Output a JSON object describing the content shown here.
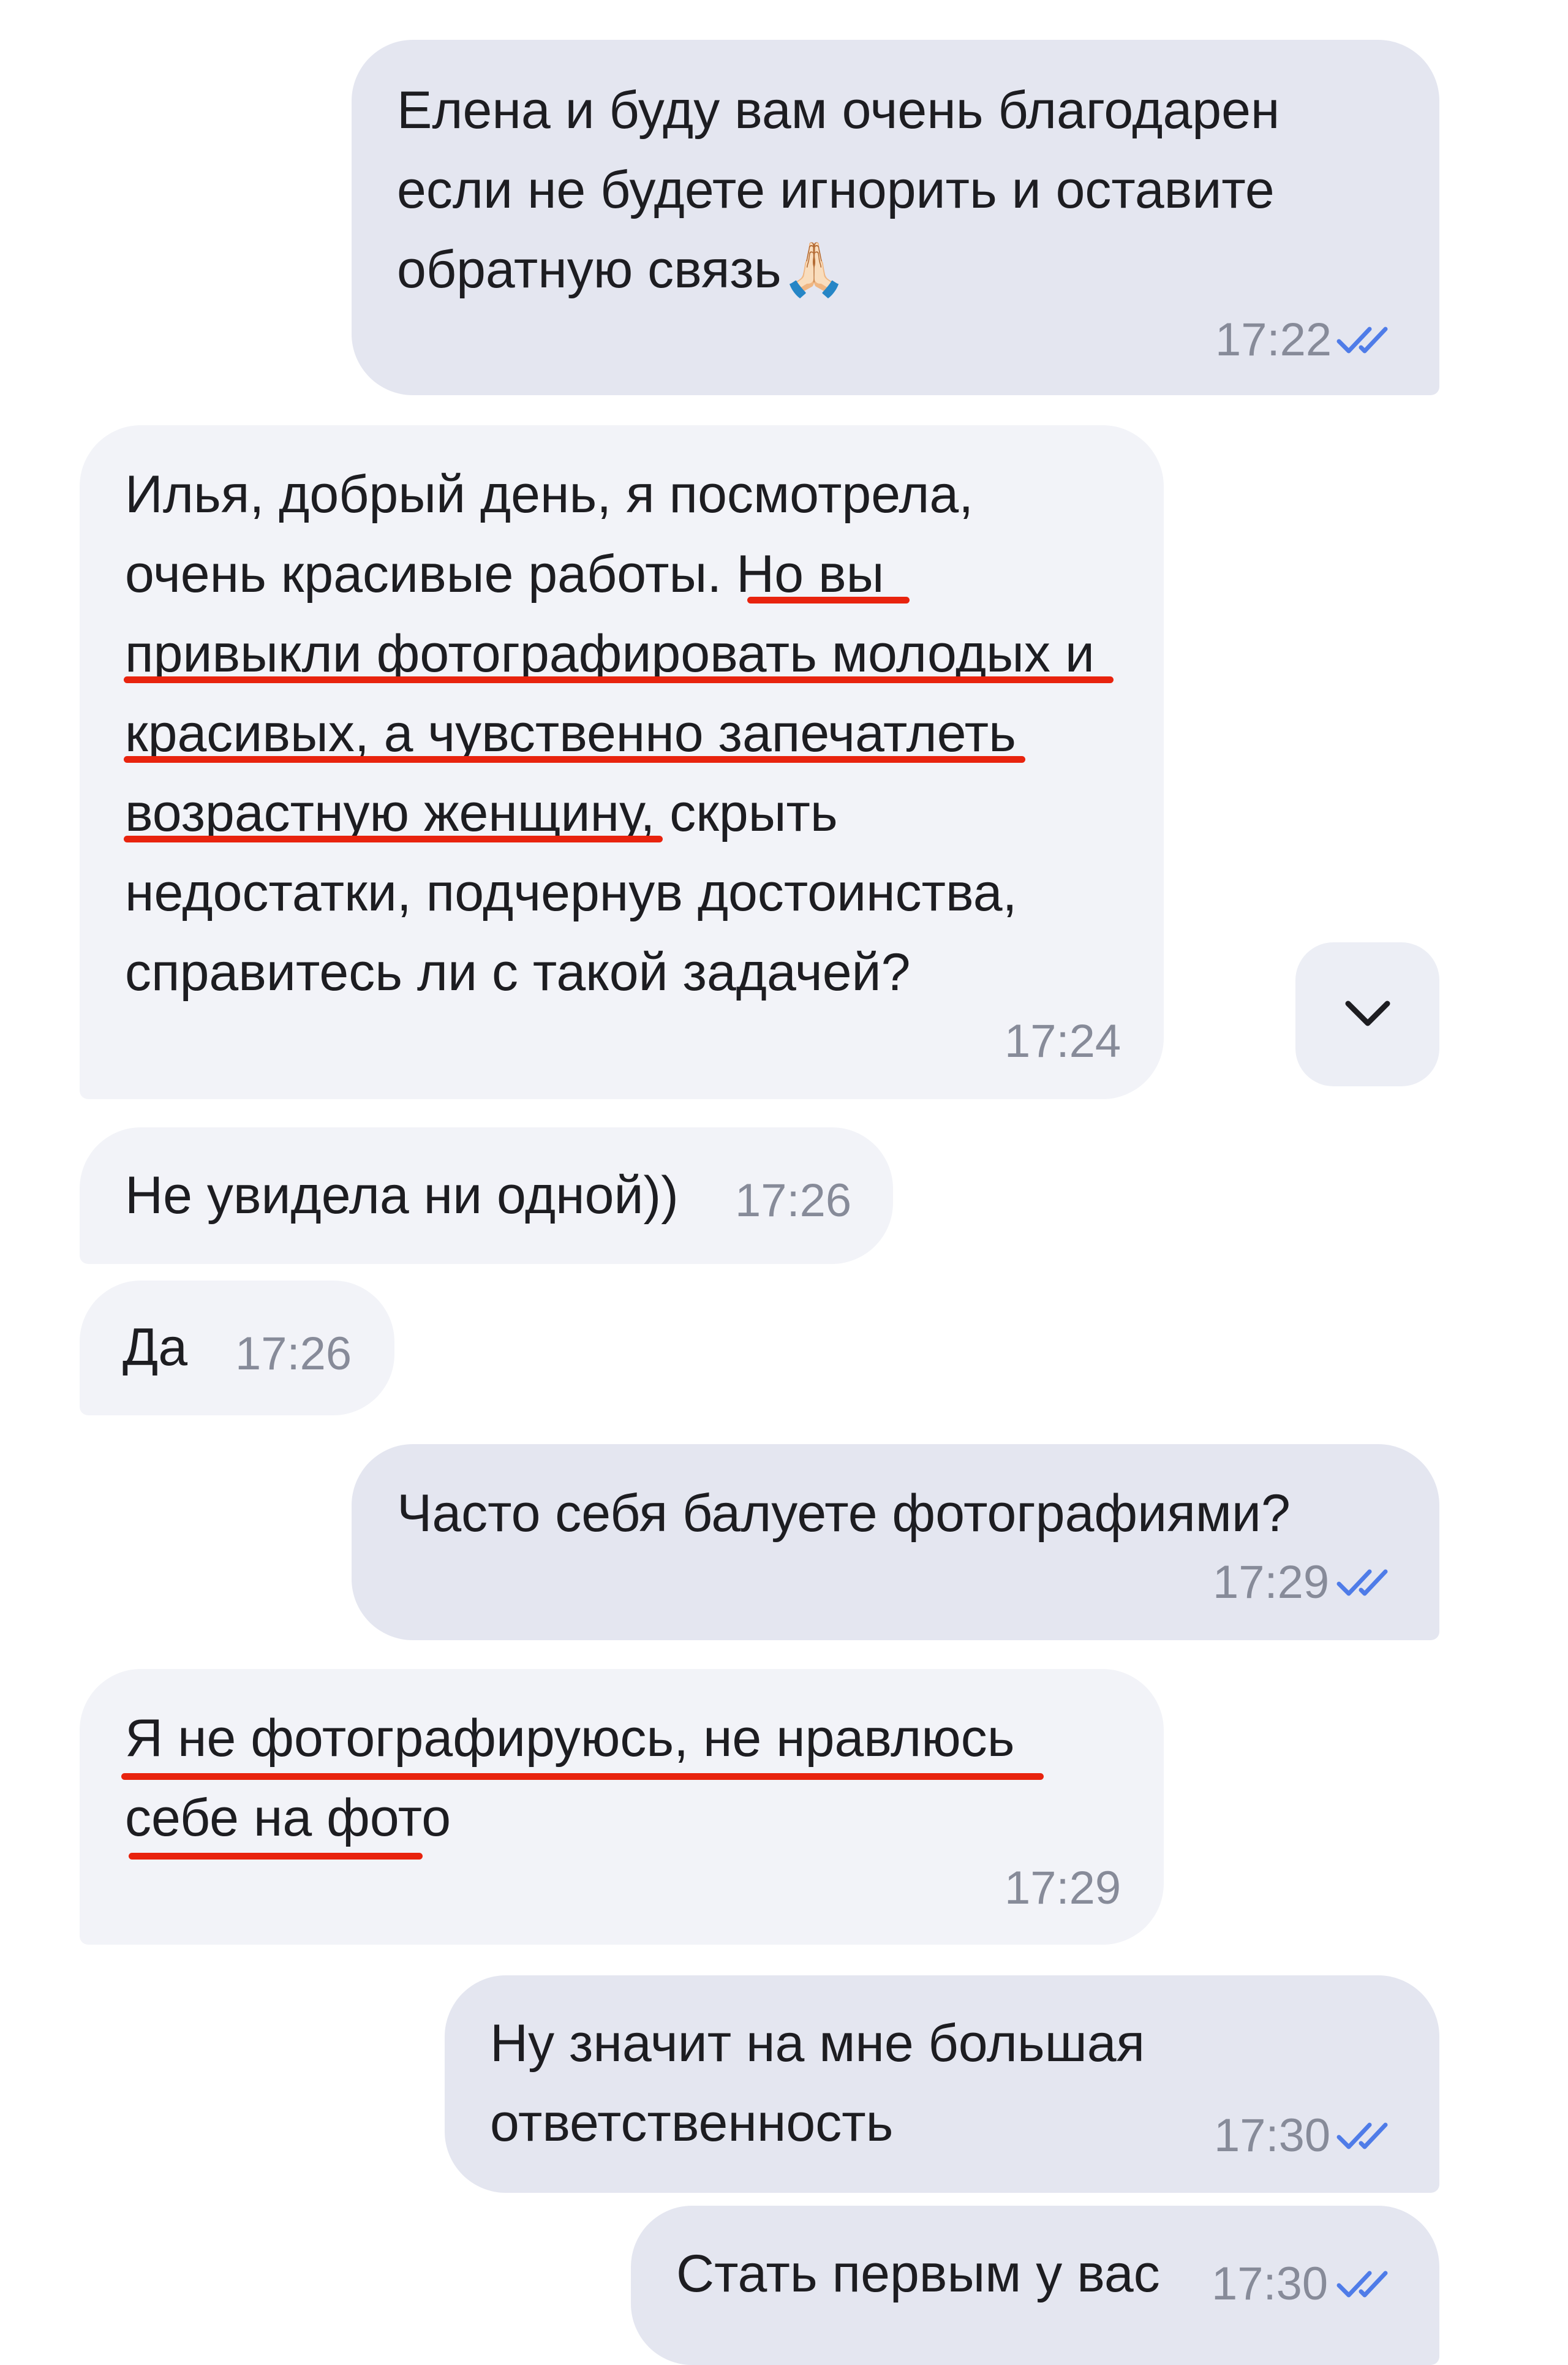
{
  "messages": [
    {
      "lines": [
        "Елена и буду вам очень благодарен",
        "если не будете игнорить и оставите",
        "обратную связь🙏🏻"
      ],
      "time": "17:22",
      "direction": "out",
      "read": true
    },
    {
      "lines": [
        "Илья, добрый день, я посмотрела,",
        "очень красивые работы. Но вы",
        "привыкли фотографировать молодых и",
        "красивых, а чувственно запечатлеть",
        "возрастную женщину, скрыть",
        "недостатки, подчернув достоинства,",
        "справитесь ли с такой задачей?"
      ],
      "time": "17:24",
      "direction": "in"
    },
    {
      "lines": [
        "Не увидела ни одной))"
      ],
      "time": "17:26",
      "direction": "in"
    },
    {
      "lines": [
        "Да"
      ],
      "time": "17:26",
      "direction": "in"
    },
    {
      "lines": [
        "Часто себя балуете фотографиями?"
      ],
      "time": "17:29",
      "direction": "out",
      "read": true
    },
    {
      "lines": [
        "Я не фотографируюсь, не нравлюсь",
        "себе на фото"
      ],
      "time": "17:29",
      "direction": "in"
    },
    {
      "lines": [
        "Ну значит на мне большая",
        "ответственность"
      ],
      "time": "17:30",
      "direction": "out",
      "read": true
    },
    {
      "lines": [
        "Стать первым у вас"
      ],
      "time": "17:30",
      "direction": "out",
      "read": true
    }
  ],
  "scroll_down_icon": "chevron-down-icon",
  "colors": {
    "outgoing_bubble": "#e4e6f0",
    "incoming_bubble": "#f2f3f8",
    "read_ticks": "#4f7ce8",
    "underline": "#e8230e"
  }
}
